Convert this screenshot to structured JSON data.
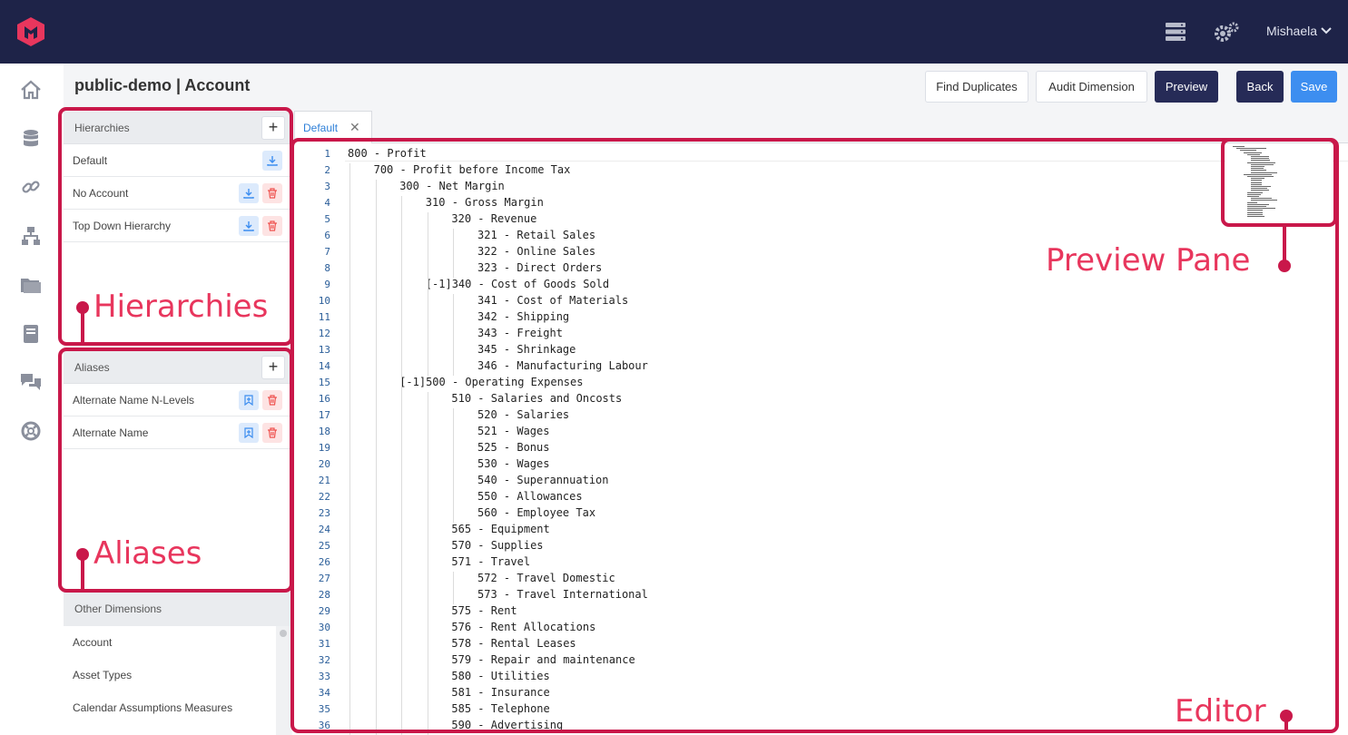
{
  "header": {
    "user_name": "Mishaela",
    "user_caret": "⌄",
    "icons": [
      "logo-icon",
      "server-icon",
      "settings-gears-icon"
    ]
  },
  "rail": {
    "icons": [
      "home-icon",
      "database-icon",
      "link-icon",
      "hierarchy-icon",
      "folder-icon",
      "book-icon",
      "chat-icon",
      "lifebuoy-icon"
    ]
  },
  "page": {
    "title": "public-demo | Account"
  },
  "toolbar": {
    "find_duplicates": "Find Duplicates",
    "audit_dimension": "Audit Dimension",
    "preview": "Preview",
    "back": "Back",
    "save": "Save"
  },
  "hierarchies": {
    "title": "Hierarchies",
    "add": "+",
    "items": [
      {
        "label": "Default"
      },
      {
        "label": "No Account"
      },
      {
        "label": "Top Down Hierarchy"
      }
    ]
  },
  "aliases": {
    "title": "Aliases",
    "add": "+",
    "items": [
      {
        "label": "Alternate Name N-Levels"
      },
      {
        "label": "Alternate Name"
      }
    ]
  },
  "other_dimensions": {
    "title": "Other Dimensions",
    "items": [
      "Account",
      "Asset Types",
      "Calendar Assumptions Measures"
    ]
  },
  "editor": {
    "tab_label": "Default",
    "tab_close": "✕",
    "lines": [
      {
        "indent": 0,
        "text": "800 - Profit"
      },
      {
        "indent": 1,
        "text": "700 - Profit before Income Tax"
      },
      {
        "indent": 2,
        "text": "300 - Net Margin"
      },
      {
        "indent": 3,
        "text": "310 - Gross Margin"
      },
      {
        "indent": 4,
        "text": "320 - Revenue"
      },
      {
        "indent": 5,
        "text": "321 - Retail Sales"
      },
      {
        "indent": 5,
        "text": "322 - Online Sales"
      },
      {
        "indent": 5,
        "text": "323 - Direct Orders"
      },
      {
        "indent": 4,
        "text": "[-1]340 - Cost of Goods Sold"
      },
      {
        "indent": 5,
        "text": "341 - Cost of Materials"
      },
      {
        "indent": 5,
        "text": "342 - Shipping"
      },
      {
        "indent": 5,
        "text": "343 - Freight"
      },
      {
        "indent": 5,
        "text": "345 - Shrinkage"
      },
      {
        "indent": 5,
        "text": "346 - Manufacturing Labour"
      },
      {
        "indent": 3,
        "text": "[-1]500 - Operating Expenses"
      },
      {
        "indent": 4,
        "text": "510 - Salaries and Oncosts"
      },
      {
        "indent": 5,
        "text": "520 - Salaries"
      },
      {
        "indent": 5,
        "text": "521 - Wages"
      },
      {
        "indent": 5,
        "text": "525 - Bonus"
      },
      {
        "indent": 5,
        "text": "530 - Wages"
      },
      {
        "indent": 5,
        "text": "540 - Superannuation"
      },
      {
        "indent": 5,
        "text": "550 - Allowances"
      },
      {
        "indent": 5,
        "text": "560 - Employee Tax"
      },
      {
        "indent": 4,
        "text": "565 - Equipment"
      },
      {
        "indent": 4,
        "text": "570 - Supplies"
      },
      {
        "indent": 4,
        "text": "571 - Travel"
      },
      {
        "indent": 5,
        "text": "572 - Travel Domestic"
      },
      {
        "indent": 5,
        "text": "573 - Travel International"
      },
      {
        "indent": 4,
        "text": "575 - Rent"
      },
      {
        "indent": 4,
        "text": "576 - Rent Allocations"
      },
      {
        "indent": 4,
        "text": "578 - Rental Leases"
      },
      {
        "indent": 4,
        "text": "579 - Repair and maintenance"
      },
      {
        "indent": 4,
        "text": "580 - Utilities"
      },
      {
        "indent": 4,
        "text": "581 - Insurance"
      },
      {
        "indent": 4,
        "text": "585 - Telephone"
      },
      {
        "indent": 4,
        "text": "590 - Advertising"
      }
    ]
  },
  "annotations": {
    "hierarchies": "Hierarchies",
    "aliases": "Aliases",
    "preview_pane": "Preview Pane",
    "editor": "Editor",
    "color": "#c9184a",
    "text_color": "#e8365d"
  },
  "colors": {
    "topbar": "#1e2348",
    "primary_dark": "#262b57",
    "primary_blue": "#3d8ef0"
  }
}
